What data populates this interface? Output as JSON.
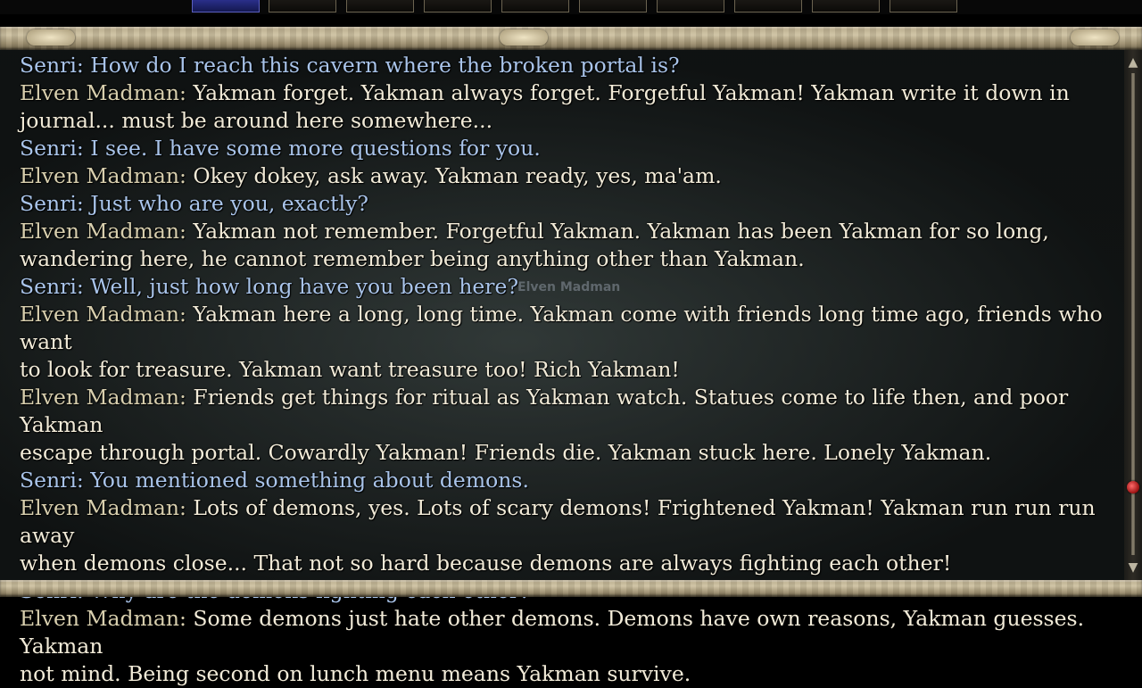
{
  "dialog": {
    "lines": [
      {
        "speaker": "Senri:",
        "text": " How do I reach this cavern where the broken portal is?"
      },
      {
        "speaker": "Elven Madman:",
        "text": " Yakman forget. Yakman always forget. Forgetful Yakman! Yakman write it down in"
      },
      {
        "speaker": "",
        "text": "journal... must be around here somewhere..."
      },
      {
        "speaker": "Senri:",
        "text": " I see. I have some more questions for you."
      },
      {
        "speaker": "Elven Madman:",
        "text": " Okey dokey, ask away. Yakman ready, yes, ma'am."
      },
      {
        "speaker": "Senri:",
        "text": " Just who are you, exactly?"
      },
      {
        "speaker": "Elven Madman:",
        "text": " Yakman not remember. Forgetful Yakman. Yakman has been Yakman for so long,"
      },
      {
        "speaker": "",
        "text": "wandering here, he cannot remember being anything other than Yakman."
      },
      {
        "speaker": "Senri:",
        "text": " Well, just how long have you been here?"
      },
      {
        "speaker": "Elven Madman:",
        "text": " Yakman here a long, long time. Yakman come with friends long time ago, friends who want"
      },
      {
        "speaker": "",
        "text": "to look for treasure. Yakman want treasure too! Rich Yakman!"
      },
      {
        "speaker": "Elven Madman:",
        "text": " Friends get things for ritual as Yakman watch. Statues come to life then, and poor Yakman"
      },
      {
        "speaker": "",
        "text": "escape through portal. Cowardly Yakman! Friends die. Yakman stuck here. Lonely Yakman."
      },
      {
        "speaker": "Senri:",
        "text": " You mentioned something about demons."
      },
      {
        "speaker": "Elven Madman:",
        "text": " Lots of demons, yes. Lots of scary demons! Frightened Yakman! Yakman run run run away"
      },
      {
        "speaker": "",
        "text": "when demons close... That not so hard because demons are always fighting each other!"
      },
      {
        "speaker": "Senri:",
        "text": " Why are the demons fighting each other?"
      },
      {
        "speaker": "Elven Madman:",
        "text": " Some demons just hate other demons. Demons have own reasons, Yakman guesses. Yakman"
      },
      {
        "speaker": "",
        "text": "not mind. Being second on lunch menu means Yakman survive."
      }
    ]
  },
  "world": {
    "npc_label": "Elven Madman"
  },
  "colors": {
    "senri": "#a9c4ea",
    "npc_name": "#d8cfae",
    "npc_text": "#f2ebd8"
  },
  "icons": {
    "scroll_up": "triangle-up-icon",
    "scroll_down": "triangle-down-icon"
  }
}
